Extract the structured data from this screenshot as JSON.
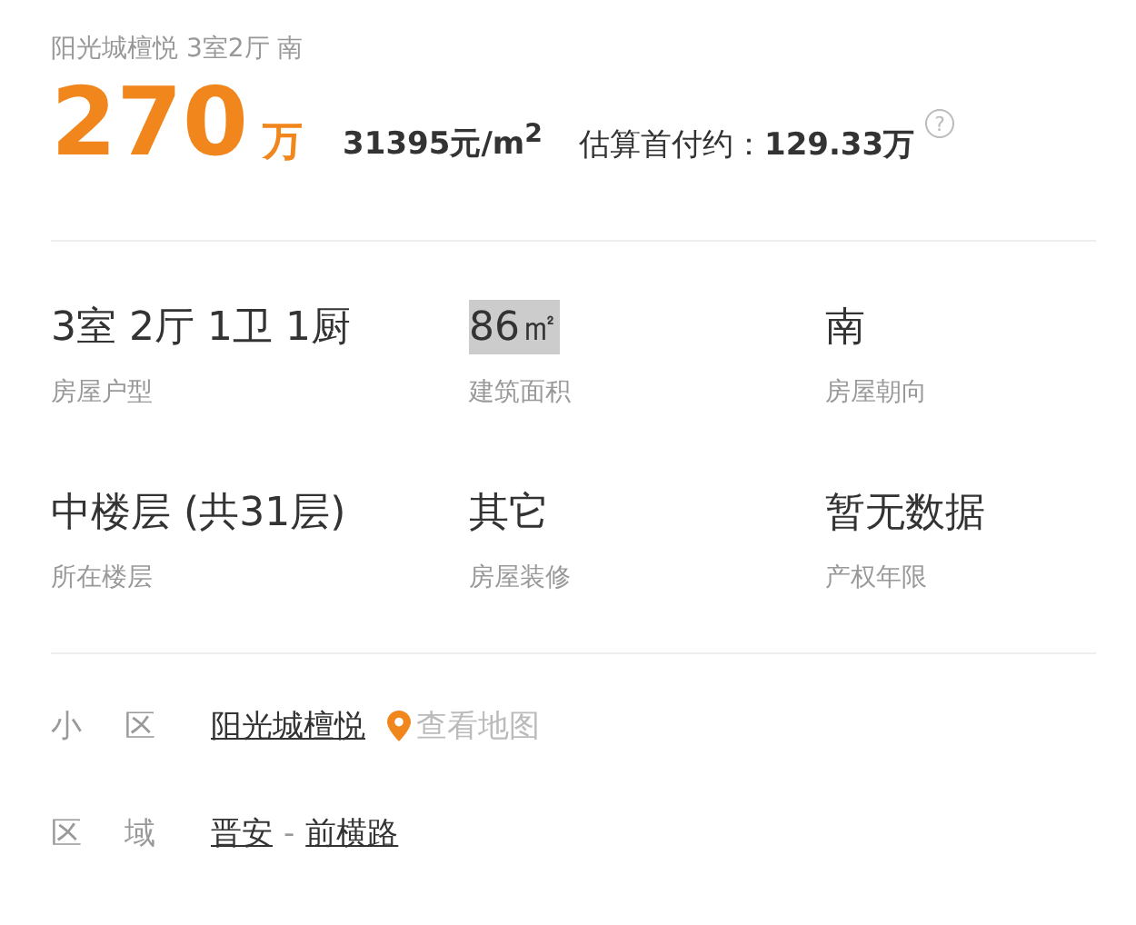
{
  "title": "阳光城檀悦 3室2厅 南",
  "price": {
    "amount": "270",
    "unit": "万",
    "unit_price": "31395元/m$^{2}$",
    "down_payment_label": "估算首付约：",
    "down_payment": "129.33万",
    "help": "?"
  },
  "attributes": [
    {
      "value": "3室 2厅 1卫 1厨",
      "label": "房屋户型",
      "highlighted": false
    },
    {
      "value": "86㎡",
      "label": "建筑面积",
      "highlighted": true
    },
    {
      "value": "南",
      "label": "房屋朝向",
      "highlighted": false
    },
    {
      "value": "中楼层 (共31层)",
      "label": "所在楼层",
      "highlighted": false
    },
    {
      "value": "其它",
      "label": "房屋装修",
      "highlighted": false
    },
    {
      "value": "暂无数据",
      "label": "产权年限",
      "highlighted": false
    }
  ],
  "community": {
    "label": "小 区",
    "name": "阳光城檀悦",
    "map_link": "查看地图"
  },
  "area": {
    "label": "区 域",
    "district": "晋安",
    "separator": "-",
    "road": "前横路"
  }
}
